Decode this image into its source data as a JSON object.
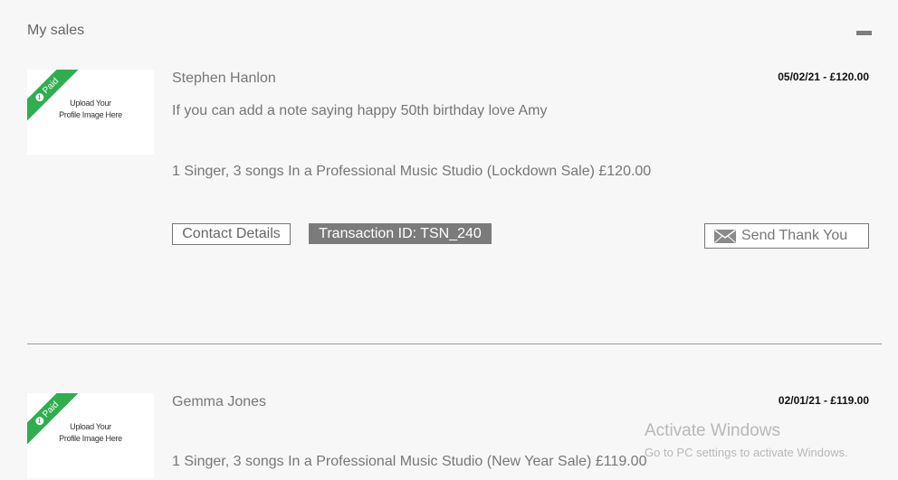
{
  "section": {
    "title": "My sales",
    "collapse_icon": "minus-icon"
  },
  "thumbnail": {
    "upload_text_line1": "Upload Your",
    "upload_text_line2": "Profile Image Here",
    "paid_label": "Paid",
    "paid_color": "#2fae4e"
  },
  "sales": [
    {
      "customer": "Stephen Hanlon",
      "date_amount": "05/02/21 - £120.00",
      "note": "If you can add a note saying happy 50th birthday love Amy",
      "product": "1 Singer, 3 songs In a Professional Music Studio (Lockdown Sale) £120.00",
      "contact_label": "Contact Details",
      "transaction_label": "Transaction ID: TSN_240",
      "thanks_label": "Send Thank You"
    },
    {
      "customer": "Gemma Jones",
      "date_amount": "02/01/21 - £119.00",
      "product": "1 Singer, 3 songs In a Professional Music Studio (New Year Sale) £119.00"
    }
  ],
  "watermark": {
    "title": "Activate Windows",
    "subtitle": "Go to PC settings to activate Windows."
  },
  "colors": {
    "background": "#f7f7f7",
    "badge": "#7b7b7b",
    "text_muted": "#777777"
  }
}
